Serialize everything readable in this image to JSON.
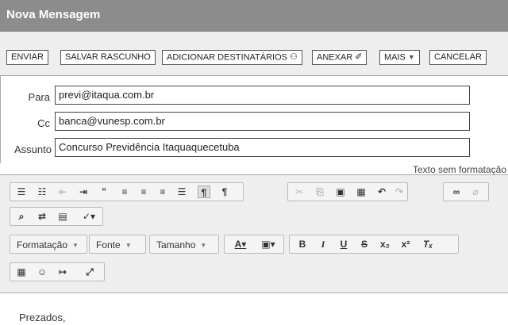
{
  "window": {
    "title": "Nova Mensagem"
  },
  "actions": {
    "send": "ENVIAR",
    "save_draft": "SALVAR RASCUNHO",
    "add_recipients": "ADICIONAR DESTINATÁRIOS",
    "attach": "ANEXAR",
    "more": "MAIS",
    "cancel": "CANCELAR"
  },
  "fields": {
    "to": {
      "label": "Para",
      "value": "previ@itaqua.com.br"
    },
    "cc": {
      "label": "Cc",
      "value": "banca@vunesp.com.br"
    },
    "subject": {
      "label": "Assunto",
      "value": "Concurso Previdência Itaquaquecetuba"
    }
  },
  "editor": {
    "plain_text_link": "Texto sem formatação",
    "format_combo": "Formatação",
    "font_combo": "Fonte",
    "size_combo": "Tamanho",
    "icons": [
      "numbered-list-icon",
      "bullet-list-icon",
      "outdent-icon",
      "indent-icon",
      "blockquote-icon",
      "align-left-icon",
      "align-center-icon",
      "align-right-icon",
      "justify-icon",
      "ltr-icon",
      "rtl-icon",
      "cut-icon",
      "copy-icon",
      "paste-icon",
      "paste-from-word-icon",
      "undo-icon",
      "redo-icon",
      "link-icon",
      "unlink-icon",
      "find-icon",
      "replace-icon",
      "select-all-icon",
      "spellcheck-icon",
      "text-color-icon",
      "background-color-icon",
      "bold-icon",
      "italic-icon",
      "underline-icon",
      "strikethrough-icon",
      "subscript-icon",
      "superscript-icon",
      "remove-format-icon",
      "table-icon",
      "smiley-icon",
      "page-break-icon",
      "maximize-icon"
    ]
  },
  "body": {
    "text": "Prezados,"
  }
}
